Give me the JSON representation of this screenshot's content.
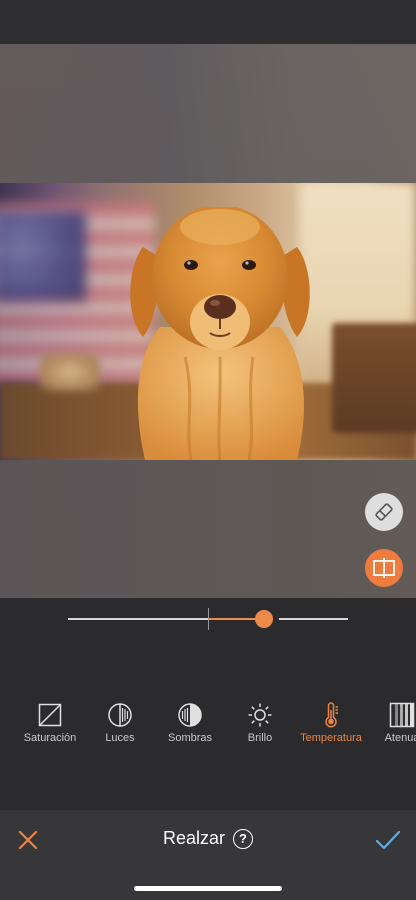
{
  "editor": {
    "title": "Realzar",
    "help_symbol": "?"
  },
  "adjustment": {
    "active_tool": "Temperatura",
    "slider_value_fraction": 0.7,
    "slider_neutral_fraction": 0.5
  },
  "tools": [
    {
      "label": "Saturación",
      "icon": "saturation-icon",
      "active": false
    },
    {
      "label": "Luces",
      "icon": "highlights-icon",
      "active": false
    },
    {
      "label": "Sombras",
      "icon": "shadows-icon",
      "active": false
    },
    {
      "label": "Brillo",
      "icon": "brightness-sun-icon",
      "active": false
    },
    {
      "label": "Temperatura",
      "icon": "thermometer-icon",
      "active": true
    },
    {
      "label": "Atenua",
      "icon": "fade-icon",
      "active": false
    }
  ],
  "colors": {
    "accent": "#ee8442",
    "confirm": "#5aaee8",
    "background": "#2b2b2d"
  }
}
